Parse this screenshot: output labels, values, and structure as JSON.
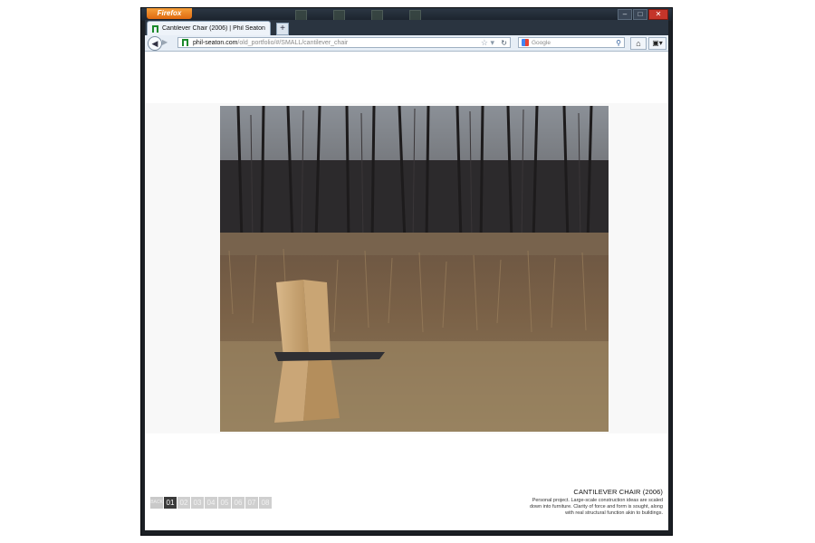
{
  "browser": {
    "menu_label": "Firefox",
    "tab": {
      "title": "Cantilever Chair (2006) | Phil Seaton"
    },
    "new_tab_symbol": "+",
    "url": {
      "domain": "phil-seaton.com",
      "path": "/old_portfolio/#/SMALL/cantilever_chair"
    },
    "search_placeholder": "Google",
    "window_controls": {
      "minimize": "–",
      "maximize": "□",
      "close": "✕"
    }
  },
  "page": {
    "photo_alt": "Cantilever chair in a field",
    "pager": {
      "back_label": "BACK",
      "pages": [
        "01",
        "02",
        "03",
        "04",
        "05",
        "06",
        "07",
        "08"
      ],
      "active_index": 0
    },
    "caption": {
      "title": "CANTILEVER CHAIR (2006)",
      "lines": [
        "Personal project. Large-scale construction ideas are scaled",
        "down into furniture. Clarity of force and form is sought, along",
        "with real structural function akin to buildings."
      ]
    }
  },
  "colors": {
    "firefox_orange": "#e06a10",
    "active_page": "#3b3b3b",
    "inactive_page": "#cfcfcf"
  }
}
